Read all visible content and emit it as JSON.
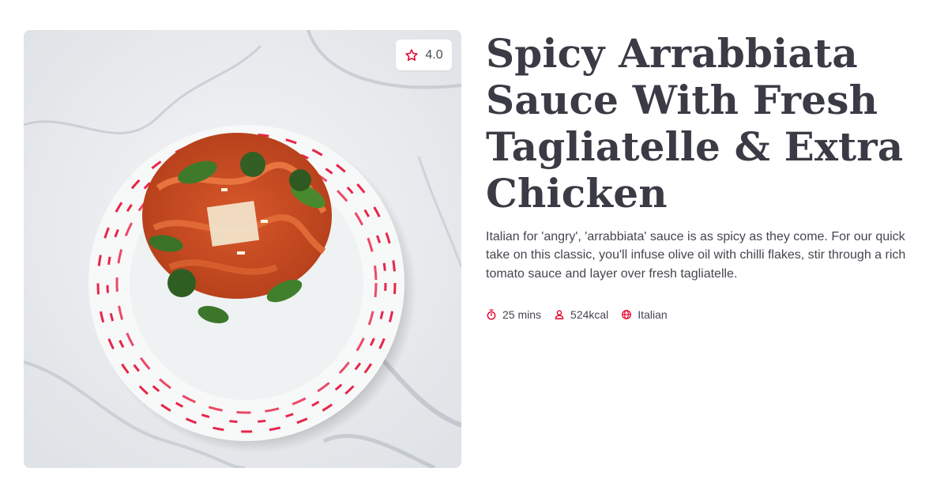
{
  "recipe": {
    "image_alt": "",
    "rating": "4.0",
    "title": "Spicy Arrabbiata Sauce With Fresh Tagliatelle & Extra Chicken",
    "description": "Italian for 'angry', 'arrabbiata' sauce is as spicy as they come. For our quick take on this classic, you'll infuse olive oil with chilli flakes, stir through a rich tomato sauce and layer over fresh tagliatelle.",
    "meta": {
      "time": "25 mins",
      "calories": "524kcal",
      "cuisine": "Italian"
    }
  },
  "icons": {
    "rating": "star-outline-icon",
    "time": "stopwatch-icon",
    "calories": "person-icon",
    "cuisine": "globe-icon"
  },
  "colors": {
    "accent": "#e4002b",
    "title": "#3a3b45",
    "text": "#45464f"
  }
}
